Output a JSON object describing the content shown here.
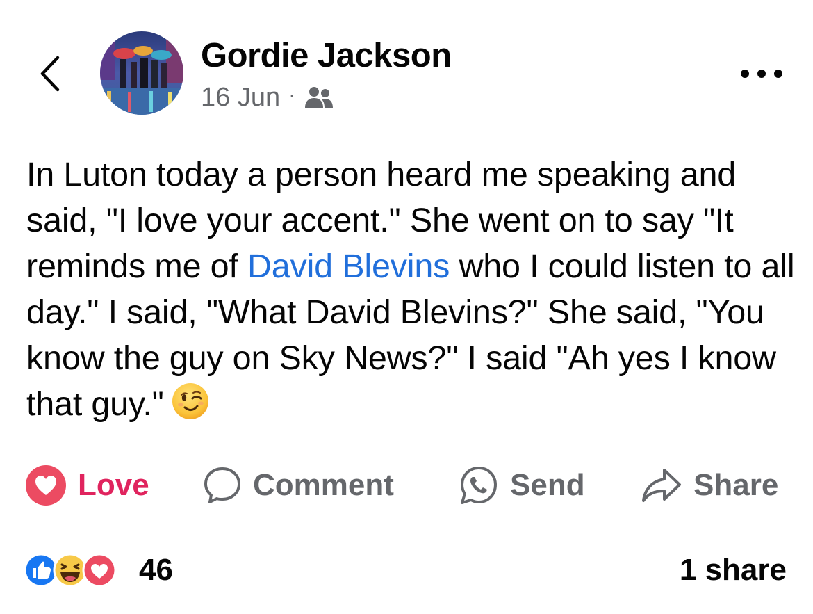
{
  "post": {
    "author_name": "Gordie Jackson",
    "date": "16 Jun",
    "meta_separator": "·",
    "audience_icon": "friends-icon",
    "text_before_mention": "In Luton today a person heard me speaking and said, \"I love your accent.\"  She went on to say \"It reminds me of ",
    "mention": "David Blevins",
    "text_after_mention": " who I could listen to all day.\" I said, \"What David Blevins?\" She said, \"You know the guy on Sky News?\" I said \"Ah yes I know that guy.\"",
    "emoji": "winking-face-emoji"
  },
  "actions": {
    "love_label": "Love",
    "comment_label": "Comment",
    "send_label": "Send",
    "share_label": "Share"
  },
  "stats": {
    "reaction_icons": [
      "like-icon",
      "haha-icon",
      "love-icon"
    ],
    "reaction_count": "46",
    "share_count": "1 share"
  },
  "colors": {
    "mention": "#216fdb",
    "love_active": "#e0245e",
    "secondary_text": "#65676b",
    "like_blue": "#1877f2"
  }
}
